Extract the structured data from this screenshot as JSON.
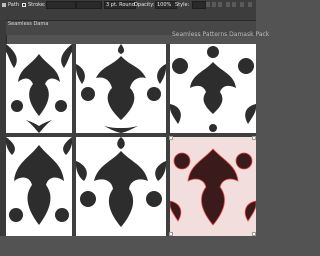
{
  "control_bar": {
    "selection_label": "Path",
    "stroke_label": "Stroke:",
    "opacity_label": "Opacity:",
    "opacity_value": "100%",
    "style_label": "Style:",
    "size_value": "3 pt. Round"
  },
  "document_tab": {
    "title": "Seamless Damask.ai"
  },
  "artboard": {
    "label": "Seamless Patterns Damask Pack"
  },
  "tiles": [
    {
      "name": "damask-tile-1",
      "color": "#2d2d2d",
      "selected": false
    },
    {
      "name": "damask-tile-2",
      "color": "#2d2d2d",
      "selected": false
    },
    {
      "name": "damask-tile-3",
      "color": "#2d2d2d",
      "selected": false
    },
    {
      "name": "damask-tile-4",
      "color": "#2d2d2d",
      "selected": false
    },
    {
      "name": "damask-tile-5",
      "color": "#2d2d2d",
      "selected": false
    },
    {
      "name": "damask-tile-6",
      "color": "#3a1a1a",
      "selected": true,
      "selection_color": "#e04848"
    }
  ],
  "colors": {
    "app_background": "#535353",
    "panel_dark": "#3d3d3d",
    "selection_accent": "#e04848"
  }
}
